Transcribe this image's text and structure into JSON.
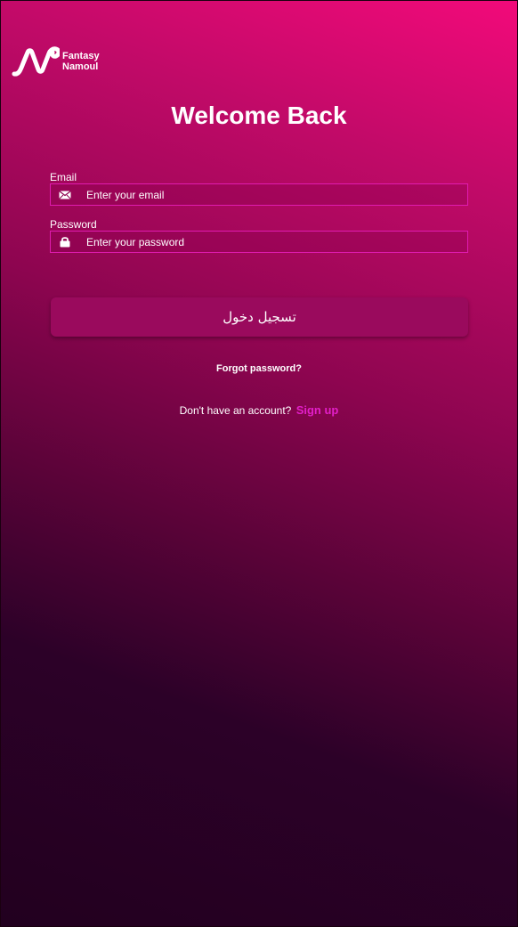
{
  "brand": {
    "line1": "Fantasy",
    "line2": "Namoul",
    "logo_icon": "brand-n-logo-icon"
  },
  "title": "Welcome Back",
  "email": {
    "label": "Email",
    "placeholder": "Enter your email",
    "icon": "mail-icon"
  },
  "password": {
    "label": "Password",
    "placeholder": "Enter your password",
    "icon": "lock-icon"
  },
  "login_button": "تسجيل دخول",
  "forgot_password": "Forgot password?",
  "signup": {
    "prompt": "Don't have an account?",
    "link": "Sign up"
  },
  "colors": {
    "accent": "#e21fc8",
    "gradient_top": "#f20a7a",
    "gradient_bottom": "#22001f",
    "button": "#9a0a5d"
  }
}
